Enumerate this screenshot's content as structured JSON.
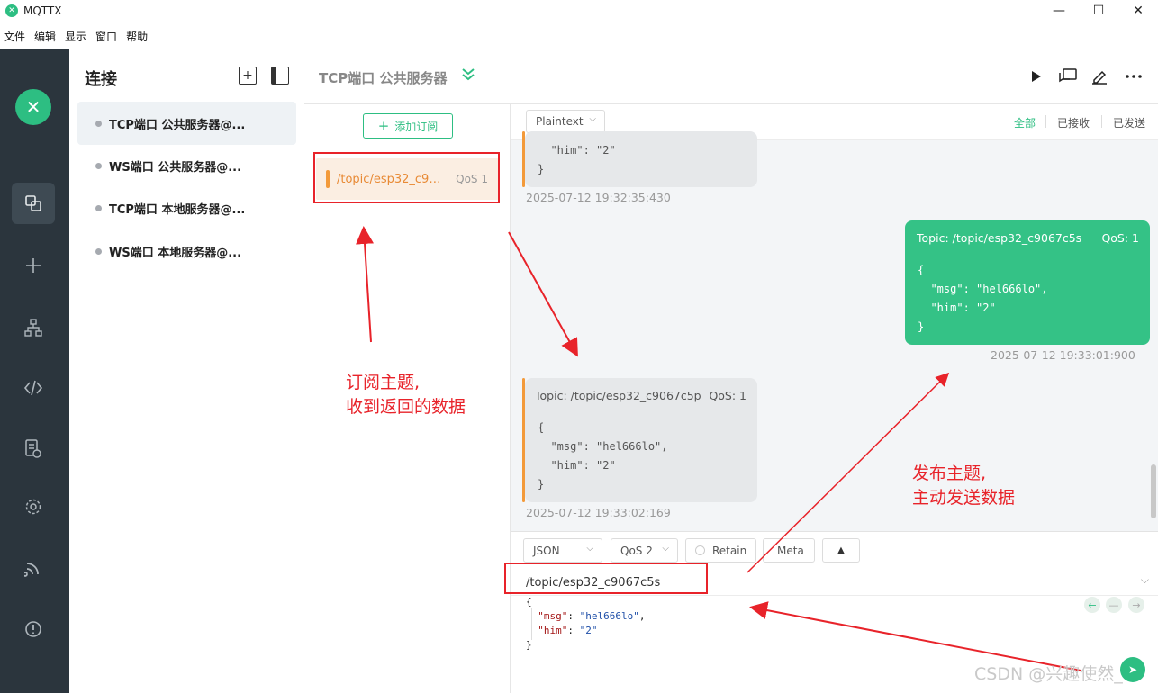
{
  "window": {
    "title": "MQTTX",
    "controls": {
      "minimize": "—",
      "maximize": "☐",
      "close": "✕"
    }
  },
  "menu": {
    "items": [
      "文件",
      "编辑",
      "显示",
      "窗口",
      "帮助"
    ]
  },
  "leftnav": {
    "icons": [
      "connections-icon",
      "plus-icon",
      "topology-icon",
      "script-icon",
      "log-icon",
      "settings-icon",
      "subscribe-icon",
      "about-icon"
    ]
  },
  "connections": {
    "title": "连接",
    "items": [
      {
        "label": "TCP端口 公共服务器@..."
      },
      {
        "label": "WS端口 公共服务器@..."
      },
      {
        "label": "TCP端口 本地服务器@..."
      },
      {
        "label": "WS端口 本地服务器@..."
      }
    ]
  },
  "header": {
    "title": "TCP端口 公共服务器"
  },
  "subscriptions": {
    "add_label": "添加订阅",
    "items": [
      {
        "topic": "/topic/esp32_c9067c5p",
        "topic_display": "/topic/esp32_c90...",
        "qos": "QoS 1",
        "color": "#f39a3a"
      }
    ]
  },
  "messages": {
    "format": "Plaintext",
    "filters": [
      "全部",
      "已接收",
      "已发送"
    ],
    "items": [
      {
        "direction": "received",
        "lines": [
          "  \"him\": \"2\"",
          "}"
        ],
        "time": "2025-07-12 19:32:35:430"
      },
      {
        "direction": "sent",
        "topic": "Topic: /topic/esp32_c9067c5s",
        "qos": "QoS: 1",
        "lines": [
          "{",
          "  \"msg\": \"hel666lo\",",
          "  \"him\": \"2\"",
          "}"
        ],
        "time": "2025-07-12 19:33:01:900"
      },
      {
        "direction": "received",
        "topic": "Topic: /topic/esp32_c9067c5p",
        "qos": "QoS: 1",
        "lines": [
          "{",
          "  \"msg\": \"hel666lo\",",
          "  \"him\": \"2\"",
          "}"
        ],
        "time": "2025-07-12 19:33:02:169"
      }
    ]
  },
  "publish": {
    "format": "JSON",
    "qos": "QoS 2",
    "retain": "Retain",
    "meta": "Meta",
    "topic": "/topic/esp32_c9067c5s",
    "payload": {
      "open": "{",
      "msg_key": "\"msg\"",
      "msg_val": "\"hel666lo\"",
      "him_key": "\"him\"",
      "him_val": "\"2\"",
      "close": "}"
    }
  },
  "annotations": {
    "subscribe_note": [
      "订阅主题,",
      "收到返回的数据"
    ],
    "publish_note": [
      "发布主题,",
      "主动发送数据"
    ]
  },
  "watermark": "CSDN @兴趣使然_",
  "colors": {
    "accent": "#2dbe82",
    "sent_bubble": "#34c286",
    "received_accent": "#f39a3a",
    "annotation": "#e8232a"
  }
}
